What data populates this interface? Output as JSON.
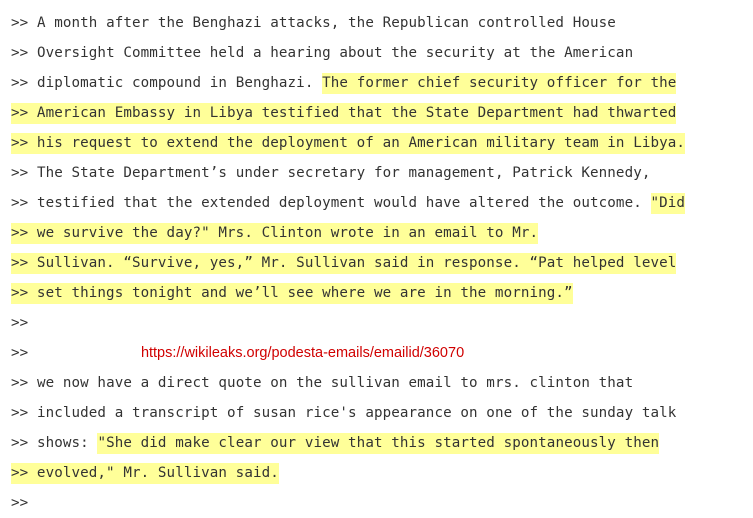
{
  "prefix": ">> ",
  "link_text": "https://wikileaks.org/podesta-emails/emailid/36070",
  "lines": [
    {
      "plain": "A month after the Benghazi attacks, the Republican controlled House",
      "hl": "",
      "tail": ""
    },
    {
      "plain": "Oversight Committee held a hearing about the security at the American",
      "hl": "",
      "tail": ""
    },
    {
      "plain": "diplomatic compound in Benghazi. ",
      "hl": "The former chief security officer for the",
      "tail": ""
    },
    {
      "plain": "",
      "hl": ">> American Embassy in Libya testified that the State Department had thwarted",
      "tail": ""
    },
    {
      "plain": "",
      "hl": ">> his request to extend the deployment of an American military team in Libya.",
      "tail": ""
    },
    {
      "plain": "The State Department’s under secretary for management, Patrick Kennedy,",
      "hl": "",
      "tail": ""
    },
    {
      "plain": "testified that the extended deployment would have altered the outcome. ",
      "hl": "\"Did",
      "tail": ""
    },
    {
      "plain": "",
      "hl": ">> we survive the day?\" Mrs. Clinton wrote in an email to Mr.",
      "tail": ""
    },
    {
      "plain": "",
      "hl": ">> Sullivan. “Survive, yes,” Mr. Sullivan said in response. “Pat helped level",
      "tail": ""
    },
    {
      "plain": "",
      "hl": ">> set things tonight and we’ll see where we are in the morning.”",
      "tail": ""
    },
    {
      "plain": "",
      "hl": "",
      "tail": ""
    },
    {
      "plain": "",
      "hl": "",
      "tail": "",
      "link": true
    },
    {
      "plain": "we now have a direct quote on the sullivan email to mrs. clinton that",
      "hl": "",
      "tail": ""
    },
    {
      "plain": "included a transcript of susan rice's appearance on one of the sunday talk",
      "hl": "",
      "tail": ""
    },
    {
      "plain": "shows: ",
      "hl": "\"She did make clear our view that this started spontaneously then",
      "tail": ""
    },
    {
      "plain": "",
      "hl": ">> evolved,\" Mr. Sullivan said.",
      "tail": ""
    },
    {
      "plain": "",
      "hl": "",
      "tail": ""
    }
  ]
}
